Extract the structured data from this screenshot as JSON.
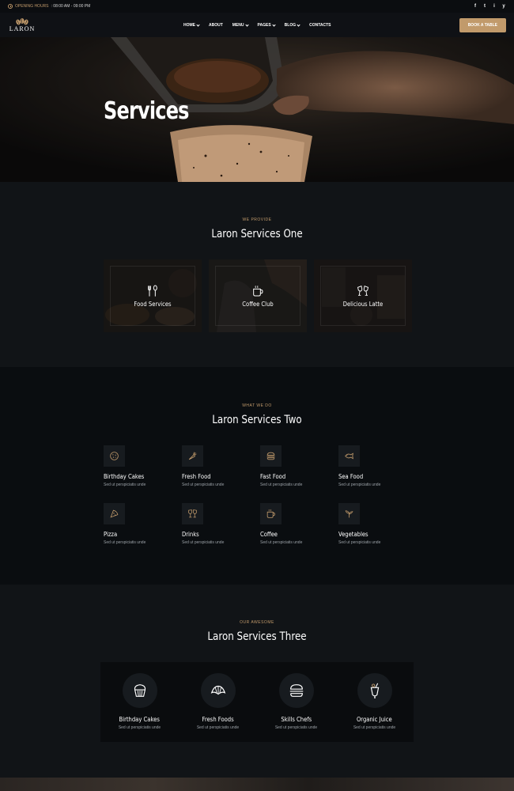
{
  "topbar": {
    "hours_label": "OPENING HOURS",
    "hours_value": ": 08:00 AM - 09:00 PM",
    "socials": [
      "f",
      "t",
      "i",
      "y"
    ],
    "social_icons": [
      "facebook-icon",
      "twitter-icon",
      "instagram-icon",
      "youtube-icon"
    ]
  },
  "nav": {
    "logo_text": "LARON",
    "items": [
      {
        "label": "HOME",
        "dropdown": true
      },
      {
        "label": "ABOUT",
        "dropdown": false
      },
      {
        "label": "MENU",
        "dropdown": true
      },
      {
        "label": "PAGES",
        "dropdown": true
      },
      {
        "label": "BLOG",
        "dropdown": true
      },
      {
        "label": "CONTACTS",
        "dropdown": false
      }
    ],
    "cta": "BOOK A TABLE"
  },
  "hero": {
    "title": "Services"
  },
  "section1": {
    "kicker": "WE PROVIDE",
    "title": "Laron Services One",
    "cards": [
      {
        "label": "Food Services",
        "icon": "fork-spoon-icon"
      },
      {
        "label": "Coffee Club",
        "icon": "coffee-cup-icon"
      },
      {
        "label": "Delicious Latte",
        "icon": "cheers-icon"
      }
    ]
  },
  "section2": {
    "kicker": "WHAT WE DO",
    "title": "Laron Services Two",
    "items": [
      {
        "name": "Birthday Cakes",
        "desc": "Sed ut perspiciatis unde",
        "icon": "cookie-icon"
      },
      {
        "name": "Fresh Food",
        "desc": "Sed ut perspiciatis unde",
        "icon": "carrot-icon"
      },
      {
        "name": "Fast Food",
        "desc": "Sed ut perspiciatis unde",
        "icon": "burger-icon"
      },
      {
        "name": "Sea Food",
        "desc": "Sed ut perspiciatis unde",
        "icon": "fish-icon"
      },
      {
        "name": "Pizza",
        "desc": "Sed ut perspiciatis unde",
        "icon": "pizza-icon"
      },
      {
        "name": "Drinks",
        "desc": "Sed ut perspiciatis unde",
        "icon": "cheers-icon"
      },
      {
        "name": "Coffee",
        "desc": "Sed ut perspiciatis unde",
        "icon": "coffee-cup-icon"
      },
      {
        "name": "Vegetables",
        "desc": "Sed ut perspiciatis unde",
        "icon": "sprout-icon"
      }
    ]
  },
  "section3": {
    "kicker": "OUR AWESOME",
    "title": "Laron Services Three",
    "items": [
      {
        "name": "Birthday Cakes",
        "desc": "Sed ut perspiciatis unde",
        "icon": "cupcake-icon"
      },
      {
        "name": "Fresh Foods",
        "desc": "Sed ut perspiciatis unde",
        "icon": "croissant-icon"
      },
      {
        "name": "Skills Chefs",
        "desc": "Sed ut perspiciatis unde",
        "icon": "burger-icon"
      },
      {
        "name": "Organic Juice",
        "desc": "Sed ut perspiciatis unde",
        "icon": "juice-icon"
      }
    ]
  },
  "colors": {
    "accent": "#c19a6b",
    "bg_dark": "#0a0d10",
    "bg": "#111417",
    "icon_stroke": "#c19a6b"
  }
}
